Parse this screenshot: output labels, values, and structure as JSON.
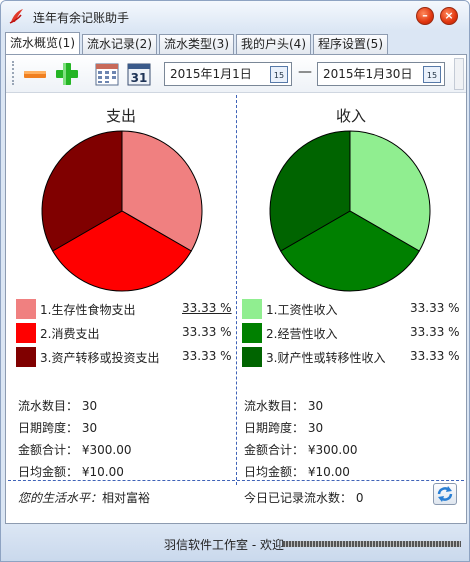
{
  "window": {
    "title": "连年有余记账助手"
  },
  "tabs": [
    {
      "label": "流水概览(1)",
      "active": true
    },
    {
      "label": "流水记录(2)",
      "active": false
    },
    {
      "label": "流水类型(3)",
      "active": false
    },
    {
      "label": "我的户头(4)",
      "active": false
    },
    {
      "label": "程序设置(5)",
      "active": false
    }
  ],
  "toolbar": {
    "calendar_day": "31",
    "date_from": "2015年1月1日",
    "date_to": "2015年1月30日",
    "date_separator": "—",
    "cal_icon_day": "15"
  },
  "expense": {
    "title": "支出",
    "items": [
      {
        "label": "1.生存性食物支出",
        "pct": "33.33 %",
        "color": "#f08080"
      },
      {
        "label": "2.消费支出",
        "pct": "33.33 %",
        "color": "#ff0000"
      },
      {
        "label": "3.资产转移或投资支出",
        "pct": "33.33 %",
        "color": "#800000"
      }
    ],
    "stats": {
      "count_label": "流水数目：",
      "count": "30",
      "span_label": "日期跨度：",
      "span": "30",
      "total_label": "金额合计：",
      "total": "¥300.00",
      "daily_label": "日均金额：",
      "daily": "¥10.00"
    }
  },
  "income": {
    "title": "收入",
    "items": [
      {
        "label": "1.工资性收入",
        "pct": "33.33 %",
        "color": "#90ee90"
      },
      {
        "label": "2.经营性收入",
        "pct": "33.33 %",
        "color": "#008000"
      },
      {
        "label": "3.财产性或转移性收入",
        "pct": "33.33 %",
        "color": "#006400"
      }
    ],
    "stats": {
      "count_label": "流水数目：",
      "count": "30",
      "span_label": "日期跨度：",
      "span": "30",
      "total_label": "金额合计：",
      "total": "¥300.00",
      "daily_label": "日均金额：",
      "daily": "¥10.00"
    }
  },
  "footer": {
    "life_label": "您的生活水平：",
    "life_value": "相对富裕",
    "today_label": "今日已记录流水数：",
    "today_value": "0"
  },
  "status": {
    "text": "羽信软件工作室 - 欢迎"
  },
  "chart_data": [
    {
      "type": "pie",
      "title": "支出",
      "categories": [
        "1.生存性食物支出",
        "2.消费支出",
        "3.资产转移或投资支出"
      ],
      "values": [
        33.33,
        33.33,
        33.33
      ],
      "colors": [
        "#f08080",
        "#ff0000",
        "#800000"
      ]
    },
    {
      "type": "pie",
      "title": "收入",
      "categories": [
        "1.工资性收入",
        "2.经营性收入",
        "3.财产性或转移性收入"
      ],
      "values": [
        33.33,
        33.33,
        33.33
      ],
      "colors": [
        "#90ee90",
        "#008000",
        "#006400"
      ]
    }
  ]
}
